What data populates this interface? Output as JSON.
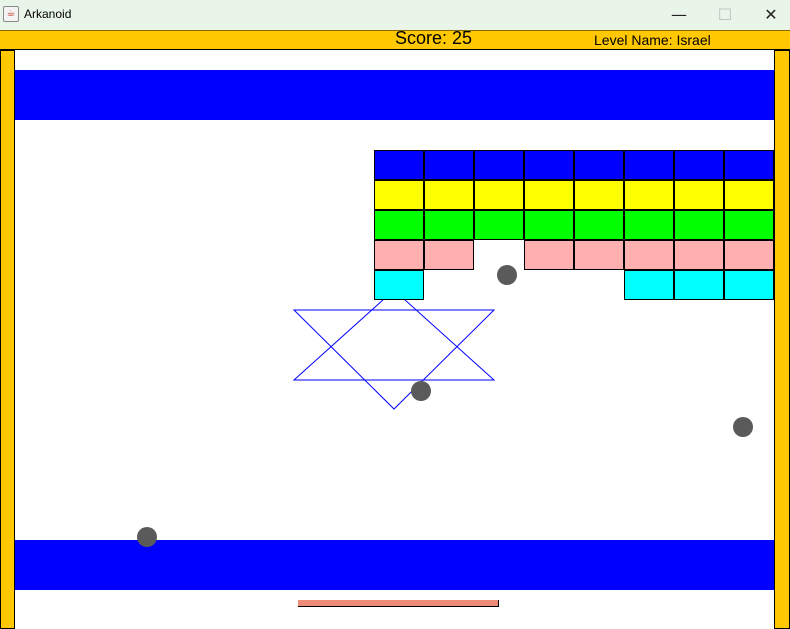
{
  "window": {
    "title": "Arkanoid",
    "app_icon": "java-icon",
    "minimize_glyph": "—",
    "maximize_glyph": "☐",
    "close_glyph": "✕"
  },
  "hud": {
    "score_label": "Score: 25",
    "level_label": "Level Name: Israel"
  },
  "colors": {
    "wall": "#ffc800",
    "stripe": "#0000ff",
    "ball": "#5a5a5a",
    "paddle": "#ee8a78",
    "star": "#0000ff",
    "background": "#ffffff"
  },
  "bricks": [
    {
      "row": 0,
      "color": "#0000ff",
      "columns": [
        0,
        1,
        2,
        3,
        4,
        5,
        6,
        7
      ]
    },
    {
      "row": 1,
      "color": "#ffff00",
      "columns": [
        0,
        1,
        2,
        3,
        4,
        5,
        6,
        7
      ]
    },
    {
      "row": 2,
      "color": "#00ff00",
      "columns": [
        0,
        1,
        2,
        3,
        4,
        5,
        6,
        7
      ]
    },
    {
      "row": 3,
      "color": "#ffafaf",
      "columns": [
        0,
        1,
        3,
        4,
        5,
        6,
        7
      ]
    },
    {
      "row": 4,
      "color": "#00ffff",
      "columns": [
        0,
        5,
        6,
        7
      ]
    }
  ],
  "balls_count": 4
}
